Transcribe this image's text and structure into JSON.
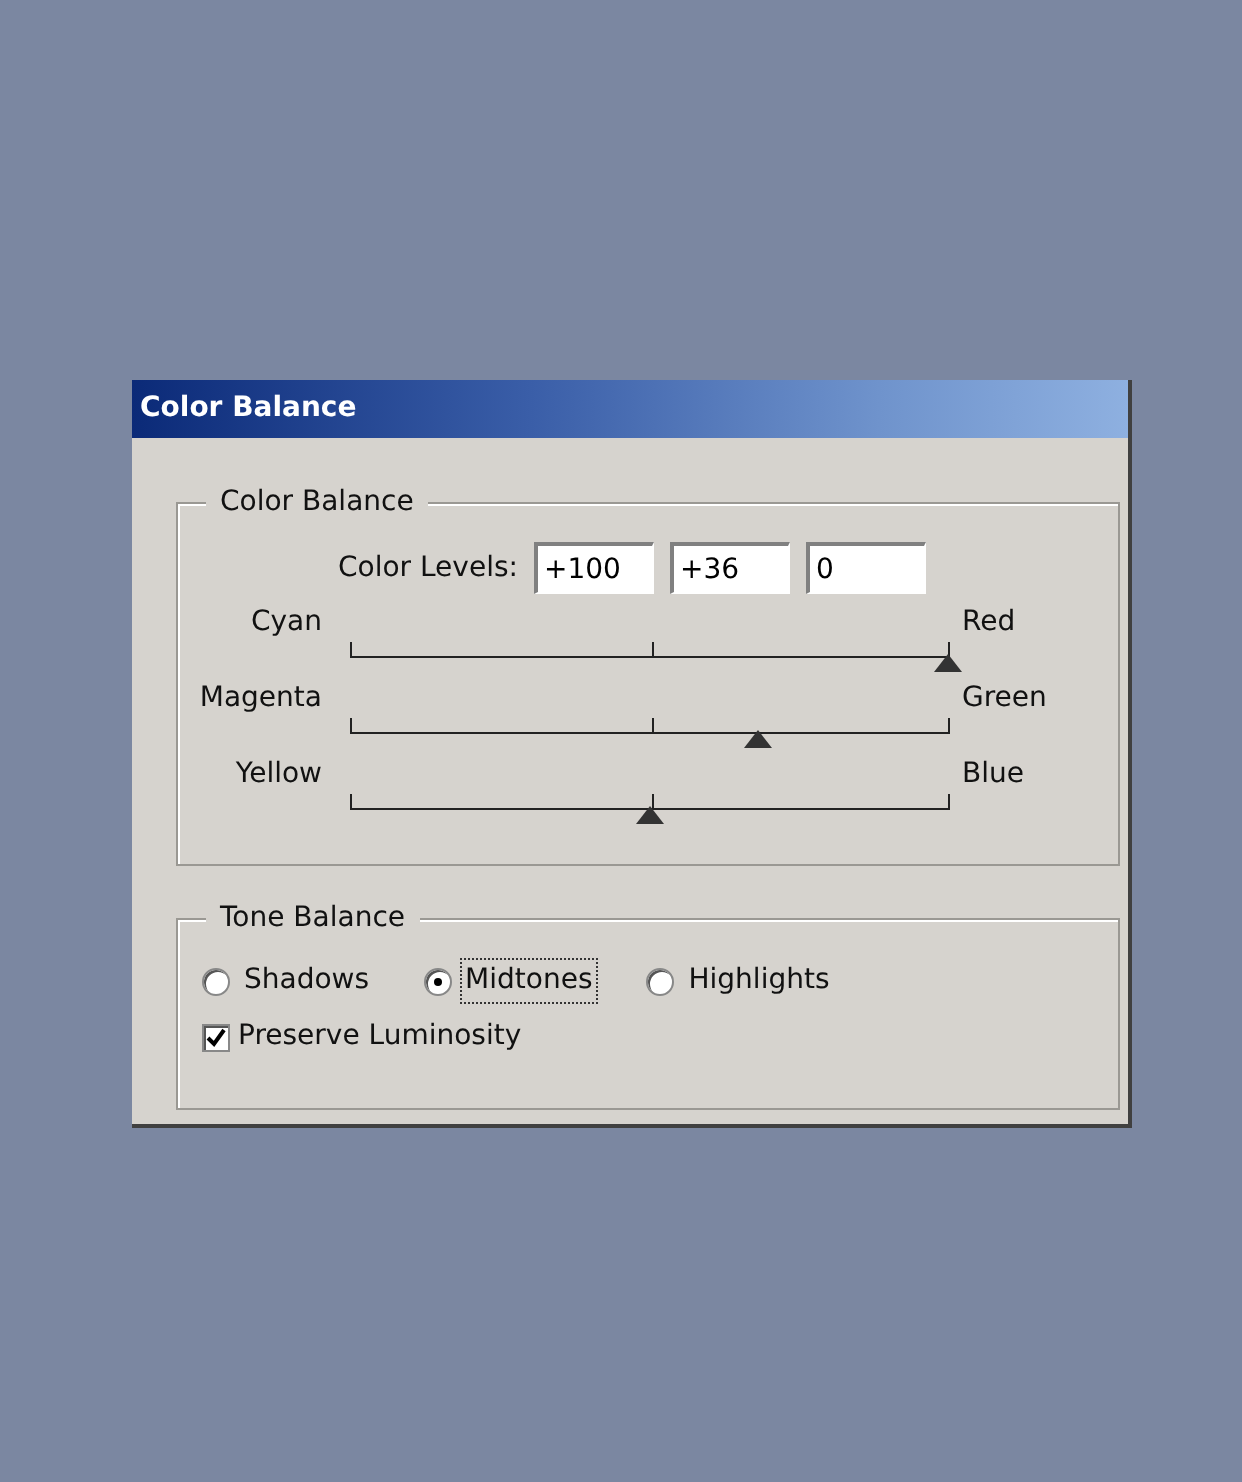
{
  "window": {
    "title": "Color Balance"
  },
  "color_balance": {
    "title": "Color Balance",
    "levels_label": "Color Levels:",
    "levels": [
      "+100",
      "+36",
      "0"
    ],
    "sliders": [
      {
        "left": "Cyan",
        "right": "Red",
        "level": 1.0
      },
      {
        "left": "Magenta",
        "right": "Green",
        "level": 0.68
      },
      {
        "left": "Yellow",
        "right": "Blue",
        "level": 0.5
      }
    ]
  },
  "tone_balance": {
    "title": "Tone Balance",
    "options": [
      {
        "label": "Shadows",
        "selected": false
      },
      {
        "label": "Midtones",
        "selected": true
      },
      {
        "label": "Highlights",
        "selected": false
      }
    ],
    "preserve_luminosity": {
      "label": "Preserve Luminosity",
      "checked": true
    }
  }
}
